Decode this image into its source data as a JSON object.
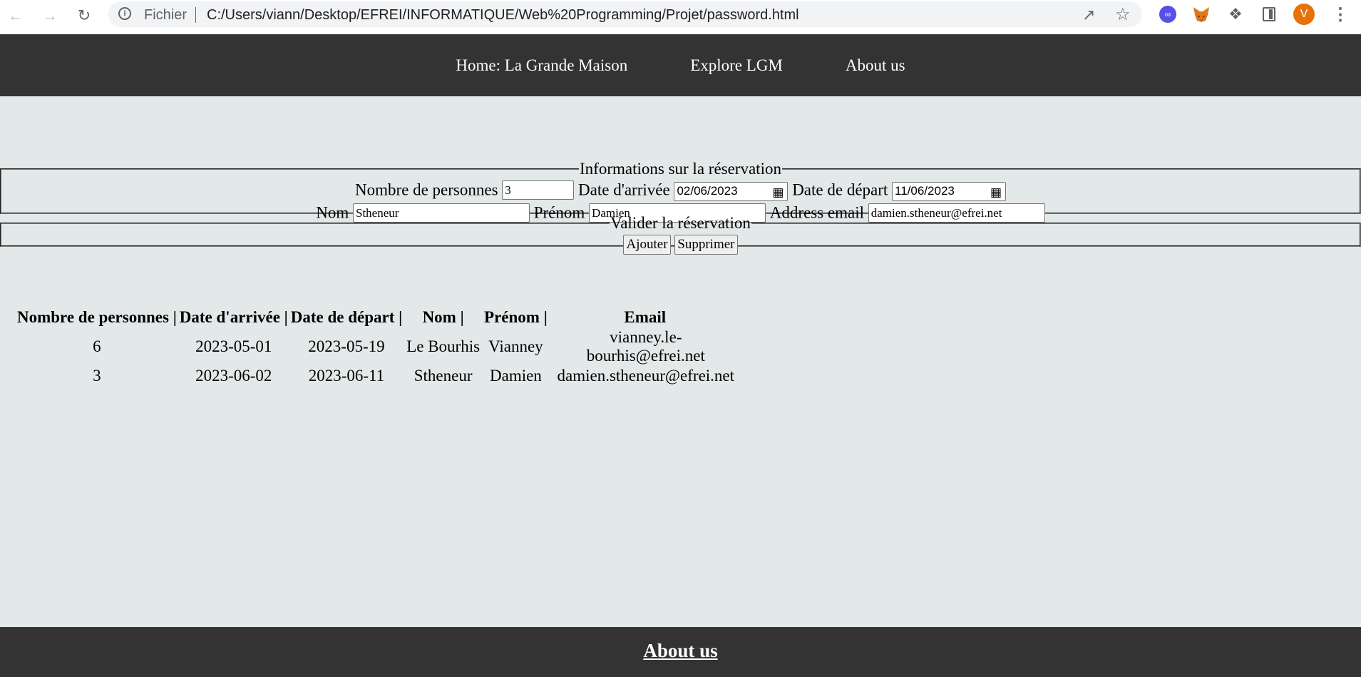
{
  "browser": {
    "scheme_label": "Fichier",
    "url": "C:/Users/viann/Desktop/EFREI/INFORMATIQUE/Web%20Programming/Projet/password.html",
    "avatar_letter": "V"
  },
  "header": {
    "nav": [
      "Home: La Grande Maison",
      "Explore LGM",
      "About us"
    ]
  },
  "form": {
    "info_legend": "Informations sur la réservation",
    "persons_label": "Nombre de personnes",
    "persons_value": "3",
    "arrival_label": "Date d'arrivée",
    "arrival_value": "02/06/2023",
    "departure_label": "Date de départ",
    "departure_value": "11/06/2023",
    "nom_label": "Nom",
    "nom_value": "Stheneur",
    "prenom_label": "Prénom",
    "prenom_value": "Damien",
    "email_label": "Address email",
    "email_value": "damien.stheneur@efrei.net",
    "validate_legend": "Valider la réservation",
    "add_label": "Ajouter",
    "delete_label": "Supprimer"
  },
  "table": {
    "headers": [
      "Nombre de personnes |",
      "Date d'arrivée |",
      "Date de départ |",
      "Nom |",
      "Prénom |",
      "Email"
    ],
    "rows": [
      [
        "6",
        "2023-05-01",
        "2023-05-19",
        "Le Bourhis",
        "Vianney",
        "vianney.le-bourhis@efrei.net"
      ],
      [
        "3",
        "2023-06-02",
        "2023-06-11",
        "Stheneur",
        "Damien",
        "damien.stheneur@efrei.net"
      ]
    ]
  },
  "footer": {
    "link": "About us"
  }
}
